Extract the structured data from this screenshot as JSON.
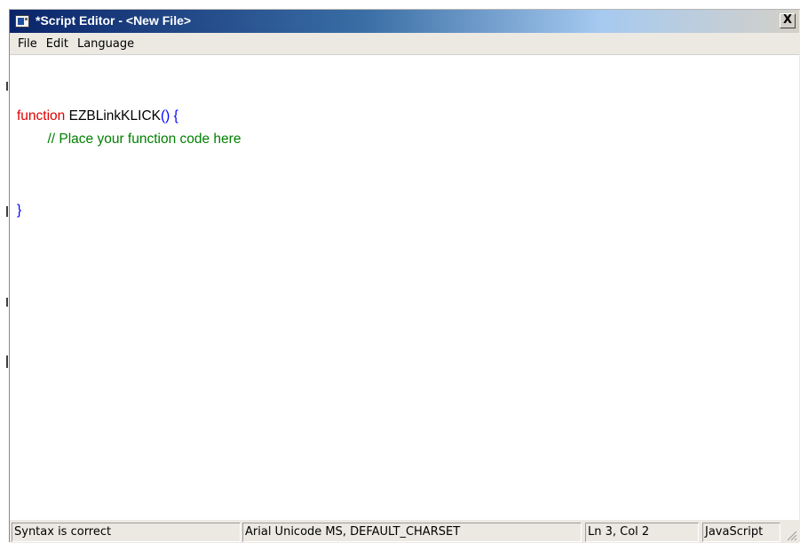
{
  "window": {
    "title": "*Script Editor - <New File>",
    "close_label": "X"
  },
  "menu": {
    "items": [
      "File",
      "Edit",
      "Language"
    ]
  },
  "editor": {
    "line1_keyword": "function",
    "line1_name": " EZBLinkKLICK",
    "line1_punc": "() {",
    "line2_comment": "        // Place your function code here",
    "line5_punc": "}"
  },
  "statusbar": {
    "syntax": "Syntax is correct",
    "font": "Arial Unicode MS, DEFAULT_CHARSET",
    "position": "Ln 3, Col 2",
    "language": "JavaScript"
  },
  "colors": {
    "keyword": "#e00000",
    "punctuation": "#0000ff",
    "comment": "#008000",
    "titlebar_start": "#0a246a"
  },
  "icons": {
    "app": "script-editor-app-icon",
    "close": "close-icon",
    "grip": "resize-grip-icon"
  }
}
